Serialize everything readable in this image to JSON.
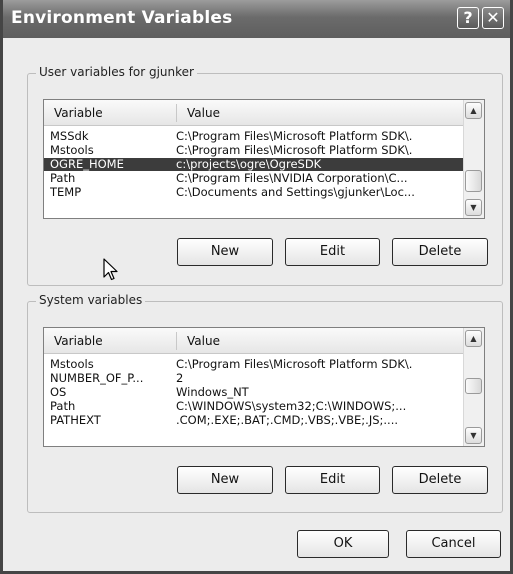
{
  "window": {
    "title": "Environment Variables",
    "help_glyph": "?",
    "close_glyph": "✕"
  },
  "user": {
    "title": "User variables for gjunker",
    "col_variable": "Variable",
    "col_value": "Value",
    "rows": [
      {
        "name": "MSSdk",
        "value": "C:\\Program Files\\Microsoft Platform SDK\\."
      },
      {
        "name": "Mstools",
        "value": "C:\\Program Files\\Microsoft Platform SDK\\."
      },
      {
        "name": "OGRE_HOME",
        "value": "c:\\projects\\ogre\\OgreSDK"
      },
      {
        "name": "Path",
        "value": "C:\\Program Files\\NVIDIA Corporation\\C..."
      },
      {
        "name": "TEMP",
        "value": "C:\\Documents and Settings\\gjunker\\Loc..."
      }
    ],
    "selected_index": 2,
    "buttons": {
      "new": "New",
      "edit": "Edit",
      "delete": "Delete"
    }
  },
  "system": {
    "title": "System variables",
    "col_variable": "Variable",
    "col_value": "Value",
    "rows": [
      {
        "name": "Mstools",
        "value": "C:\\Program Files\\Microsoft Platform SDK\\."
      },
      {
        "name": "NUMBER_OF_P...",
        "value": "2"
      },
      {
        "name": "OS",
        "value": "Windows_NT"
      },
      {
        "name": "Path",
        "value": "C:\\WINDOWS\\system32;C:\\WINDOWS;..."
      },
      {
        "name": "PATHEXT",
        "value": ".COM;.EXE;.BAT;.CMD;.VBS;.VBE;.JS;...."
      }
    ],
    "buttons": {
      "new": "New",
      "edit": "Edit",
      "delete": "Delete"
    }
  },
  "footer": {
    "ok": "OK",
    "cancel": "Cancel"
  },
  "icons": {
    "scroll_up": "scroll-up-arrow-icon",
    "scroll_down": "scroll-down-arrow-icon",
    "cursor": "mouse-pointer-icon"
  },
  "colors": {
    "selection": "#3c3c3c",
    "titlebar": "#6b6b6b"
  }
}
